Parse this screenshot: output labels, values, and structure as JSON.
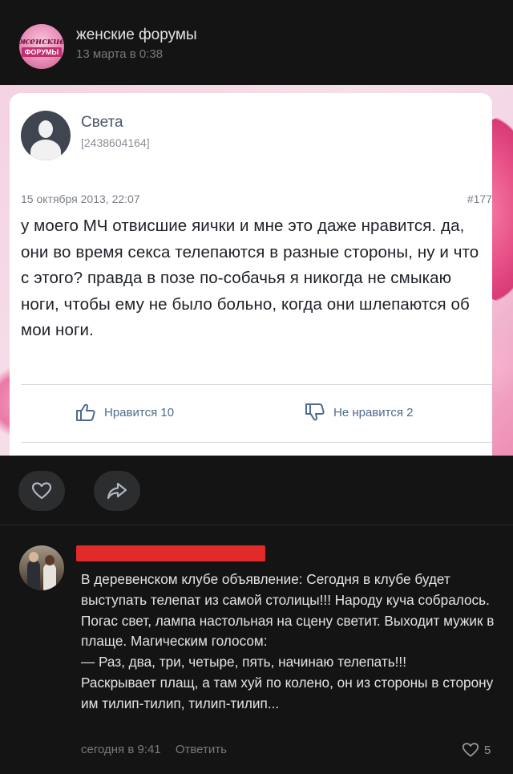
{
  "post": {
    "group_name": "женские форумы",
    "time": "13 марта в 0:38",
    "avatar_text_line1": "женские",
    "avatar_text_line2": "ФОРУМЫ"
  },
  "screenshot": {
    "user_name": "Света",
    "user_id": "[2438604164]",
    "date": "15 октября 2013, 22:07",
    "post_number": "#177",
    "message": "у моего МЧ отвисшие яички и мне это даже нравится. да, они во время секса телепаются в разные стороны, ну и что с этого? правда в позе по-собачья я никогда не смыкаю ноги, чтобы ему не было больно, когда они шлепаются об мои ноги.",
    "like_label": "Нравится 10",
    "dislike_label": "Не нравится 2"
  },
  "actions": {
    "like_icon": "heart-icon",
    "share_icon": "share-icon"
  },
  "comment": {
    "text": "В деревенском клубе объявление: Сегодня в клубе будет выступать телепат из самой столицы!!! Народу куча собралось. Погас свет, лампа настольная на сцену светит. Выходит мужик в плаще. Магическим голосом:\n— Раз, два, три, четыре, пять, начинаю телепать!!!\nРаскрывает плащ, а там хуй по колено, он из стороны в сторону им тилип-тилип, тилип-тилип...",
    "time": "сегодня в 9:41",
    "reply_label": "Ответить",
    "likes": "5"
  },
  "colors": {
    "background": "#141414",
    "redaction": "#e32a2a",
    "link_blue": "#4d6a8f"
  }
}
